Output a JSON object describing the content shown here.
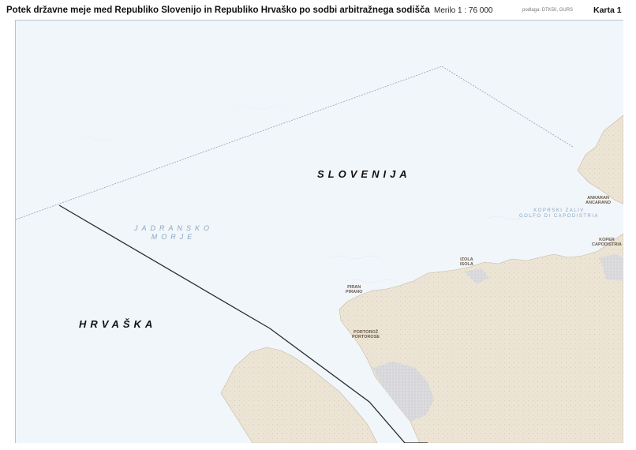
{
  "header": {
    "title": "Potek državne meje med Republiko Slovenijo in Republiko Hrvaško po sodbi arbitražnega sodišča",
    "scale": "Merilo 1 : 76 000",
    "source": "podlaga: DTK50, GURS",
    "sheet": "Karta 1"
  },
  "labels": {
    "slovenia": "SLOVENIJA",
    "croatia": "HRVAŠKA",
    "sea_line1": "JADRANSKO",
    "sea_line2": "MORJE",
    "bay_line1": "KOPRSKI ZALIV",
    "bay_line2": "GOLFO DI CAPODISTRIA"
  },
  "towns": [
    {
      "name": "ANKARAN",
      "alt": "ANCARANO"
    },
    {
      "name": "KOPER",
      "alt": "CAPODISTRIA"
    },
    {
      "name": "IZOLA",
      "alt": "ISOLA"
    },
    {
      "name": "PIRAN",
      "alt": "PIRANO"
    },
    {
      "name": "PORTOROŽ",
      "alt": "PORTOROSE"
    }
  ],
  "colors": {
    "sea": "#f1f6fb",
    "land": "#ece4d4",
    "border_line": "#2a2a2a",
    "maritime_line": "#8fa0b3",
    "sea_text": "#8aa6c0"
  }
}
